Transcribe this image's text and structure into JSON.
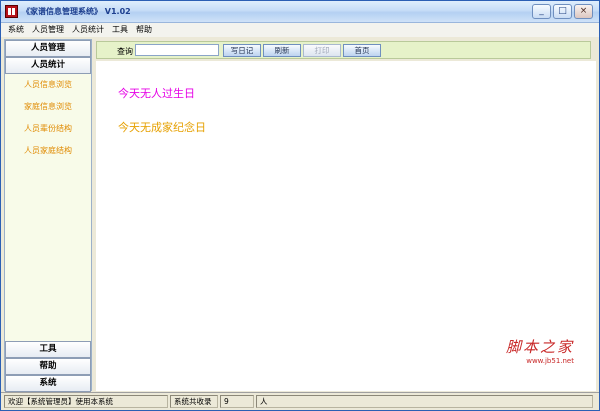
{
  "window": {
    "title": "《家谱信息管理系统》 V1.02",
    "controls": {
      "minimize": "_",
      "maximize": "□",
      "close": "×"
    }
  },
  "menu": {
    "items": [
      "系统",
      "人员管理",
      "人员统计",
      "工具",
      "帮助"
    ]
  },
  "sidebar": {
    "top_buttons": [
      "人员管理",
      "人员统计"
    ],
    "links": [
      "人员信息浏览",
      "家庭信息浏览",
      "人员辈份结构",
      "人员家庭结构"
    ],
    "bottom_buttons": [
      "工具",
      "帮助",
      "系统"
    ],
    "link_color": "#e08a00"
  },
  "toolbar": {
    "query_label": "查询",
    "query_value": "",
    "buttons": [
      {
        "label": "写日记",
        "enabled": true
      },
      {
        "label": "刷新",
        "enabled": true
      },
      {
        "label": "打印",
        "enabled": false
      },
      {
        "label": "首页",
        "enabled": true
      }
    ]
  },
  "main": {
    "birthday_msg": "今天无人过生日",
    "anniversary_msg": "今天无成家纪念日",
    "birthday_color": "#e600e6",
    "anniversary_color": "#e6a000"
  },
  "watermark": {
    "text": "脚本之家",
    "url": "www.jb51.net"
  },
  "status": {
    "welcome": "欢迎【系统管理员】使用本系统",
    "total_label": "系统共收录",
    "count": "9",
    "unit": "人"
  }
}
